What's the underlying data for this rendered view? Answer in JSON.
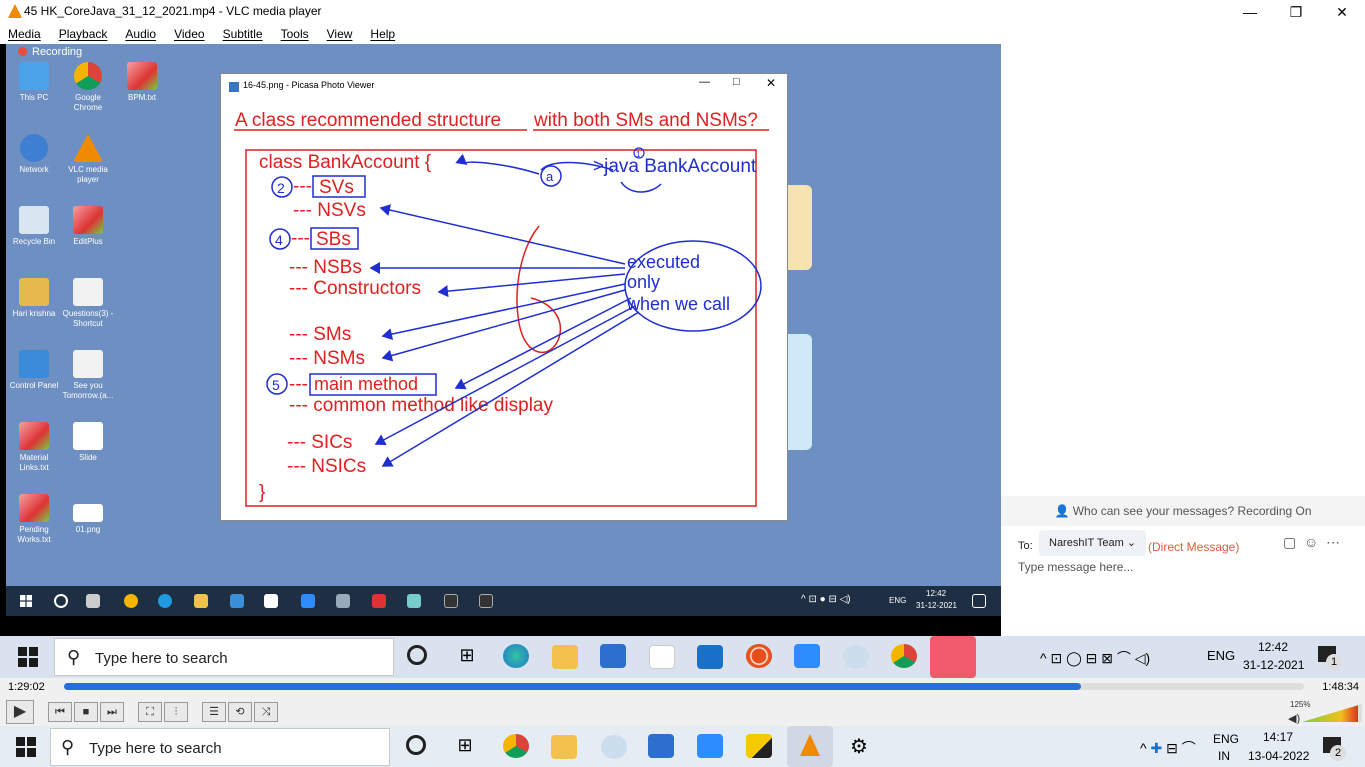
{
  "window": {
    "title": "45 HK_CoreJava_31_12_2021.mp4 - VLC media player"
  },
  "menu": [
    "Media",
    "Playback",
    "Audio",
    "Video",
    "Subtitle",
    "Tools",
    "View",
    "Help"
  ],
  "video": {
    "recording": "Recording",
    "desktop_icons": [
      {
        "label": "This PC",
        "icon": "computer-icon"
      },
      {
        "label": "Google Chrome",
        "icon": "chrome-icon"
      },
      {
        "label": "BPM.txt",
        "icon": "editplus-icon"
      },
      {
        "label": "Network",
        "icon": "network-icon"
      },
      {
        "label": "VLC media player",
        "icon": "vlc-icon"
      },
      {
        "label": "Recycle Bin",
        "icon": "recycle-bin-icon"
      },
      {
        "label": "EditPlus",
        "icon": "editplus-icon"
      },
      {
        "label": "Hari krishna",
        "icon": "user-folder-icon"
      },
      {
        "label": "Questions(3) - Shortcut",
        "icon": "image-icon"
      },
      {
        "label": "Control Panel",
        "icon": "control-panel-icon"
      },
      {
        "label": "See you Tomorrow.(a...",
        "icon": "image-icon"
      },
      {
        "label": "Material Links.txt",
        "icon": "editplus-icon"
      },
      {
        "label": "Slide",
        "icon": "image-icon"
      },
      {
        "label": "Pending Works.txt",
        "icon": "editplus-icon"
      },
      {
        "label": "01.png",
        "icon": "image-icon"
      }
    ],
    "picasa": {
      "title": "16-45.png - Picasa Photo Viewer",
      "slide": {
        "heading_left": "A class recommended structure",
        "heading_right": "with both SMs and NSMs?",
        "class_line": "class BankAccount {",
        "cmd": ">java BankAccount",
        "items": [
          "SVs",
          "--- NSVs",
          "SBs",
          "--- NSBs",
          "--- Constructors",
          "--- SMs",
          "--- NSMs",
          "main method",
          "--- common method like display",
          "--- SICs",
          "--- NSICs",
          "}"
        ],
        "dash": "---",
        "bubble": [
          "executed",
          "only",
          "when we call"
        ],
        "marks": [
          "2",
          "4",
          "5",
          "a",
          "1"
        ]
      }
    },
    "inner_taskbar": {
      "lang": "ENG",
      "time": "12:42",
      "date": "31-12-2021"
    }
  },
  "zoom_chat": {
    "notice": "Who can see your messages? Recording On",
    "to_label": "To:",
    "recipient": "NareshIT Team",
    "direct": "(Direct Message)",
    "placeholder": "Type message here..."
  },
  "taskbar_mid": {
    "search": "Type here to search",
    "lang": "ENG",
    "time": "12:42",
    "date": "31-12-2021",
    "notif": "1"
  },
  "player": {
    "elapsed": "1:29:02",
    "total": "1:48:34",
    "progress": 0.82,
    "volume": "125%"
  },
  "taskbar_bottom": {
    "search": "Type here to search",
    "lang": "ENG",
    "region": "IN",
    "time": "14:17",
    "date": "13-04-2022",
    "notif": "2"
  },
  "colors": {
    "slide_red": "#e02020",
    "slide_blue": "#1f2ed0",
    "desktop": "#6d8fc2",
    "progress": "#2a6de0"
  }
}
